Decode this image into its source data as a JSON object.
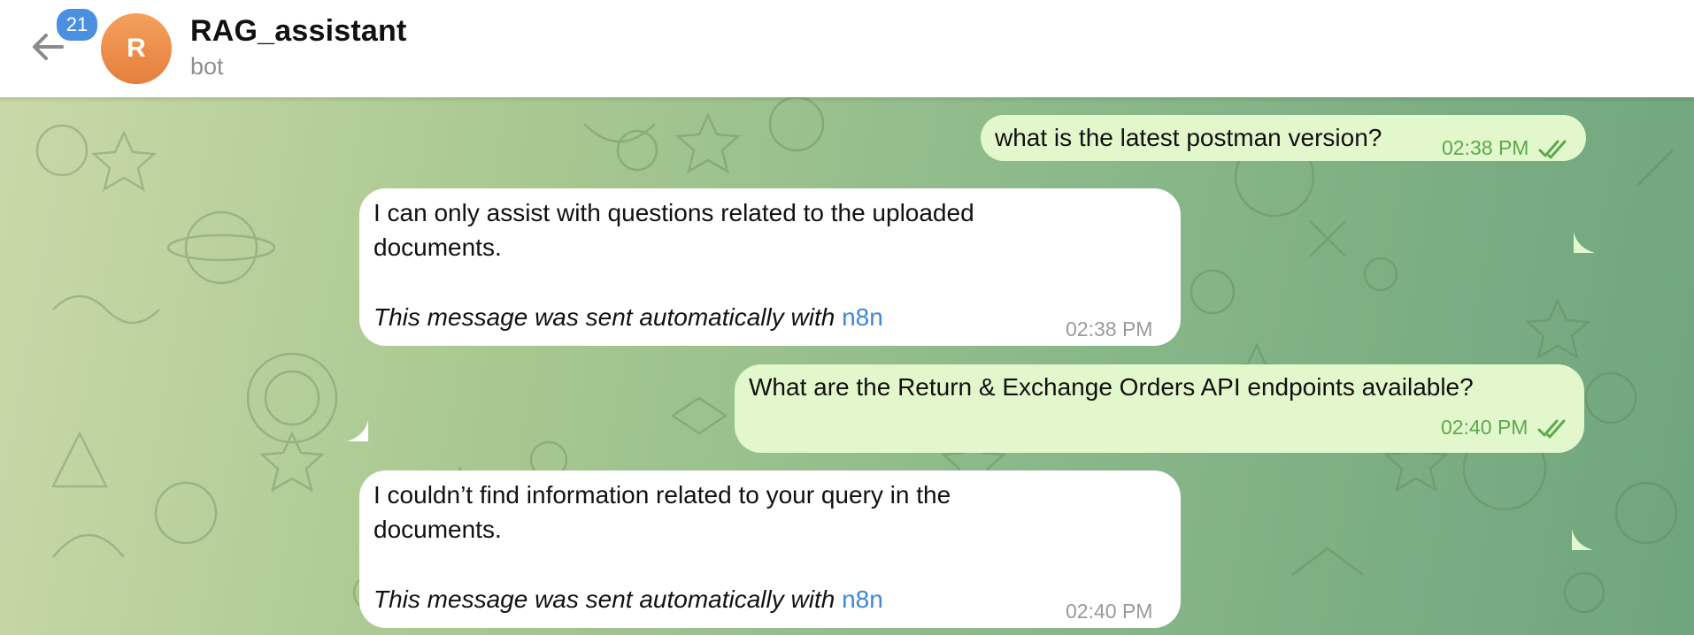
{
  "header": {
    "unread_count": "21",
    "avatar_letter": "R",
    "title": "RAG_assistant",
    "subtitle": "bot",
    "avatar_color": "#e8873f",
    "badge_color": "#4a8fe0"
  },
  "messages": [
    {
      "direction": "outgoing",
      "text": "what is the latest postman version?",
      "time": "02:38 PM",
      "status_icon": "double-check-icon"
    },
    {
      "direction": "incoming",
      "lines": [
        "I can only assist with questions related to the uploaded",
        "documents."
      ],
      "footer_text": "This message was sent automatically with ",
      "footer_link": "n8n",
      "time": "02:38 PM"
    },
    {
      "direction": "outgoing",
      "text": "What are the Return & Exchange Orders API endpoints available?",
      "time": "02:40 PM",
      "status_icon": "double-check-icon"
    },
    {
      "direction": "incoming",
      "lines": [
        "I couldn’t find information related to your query in the",
        "documents."
      ],
      "footer_text": "This message was sent automatically with ",
      "footer_link": "n8n",
      "time": "02:40 PM"
    }
  ],
  "colors": {
    "outgoing_bubble": "#e2f7cc",
    "incoming_bubble": "#ffffff",
    "link": "#3d87d8",
    "outgoing_meta": "#5da84e",
    "incoming_meta": "#9a9a9a"
  }
}
